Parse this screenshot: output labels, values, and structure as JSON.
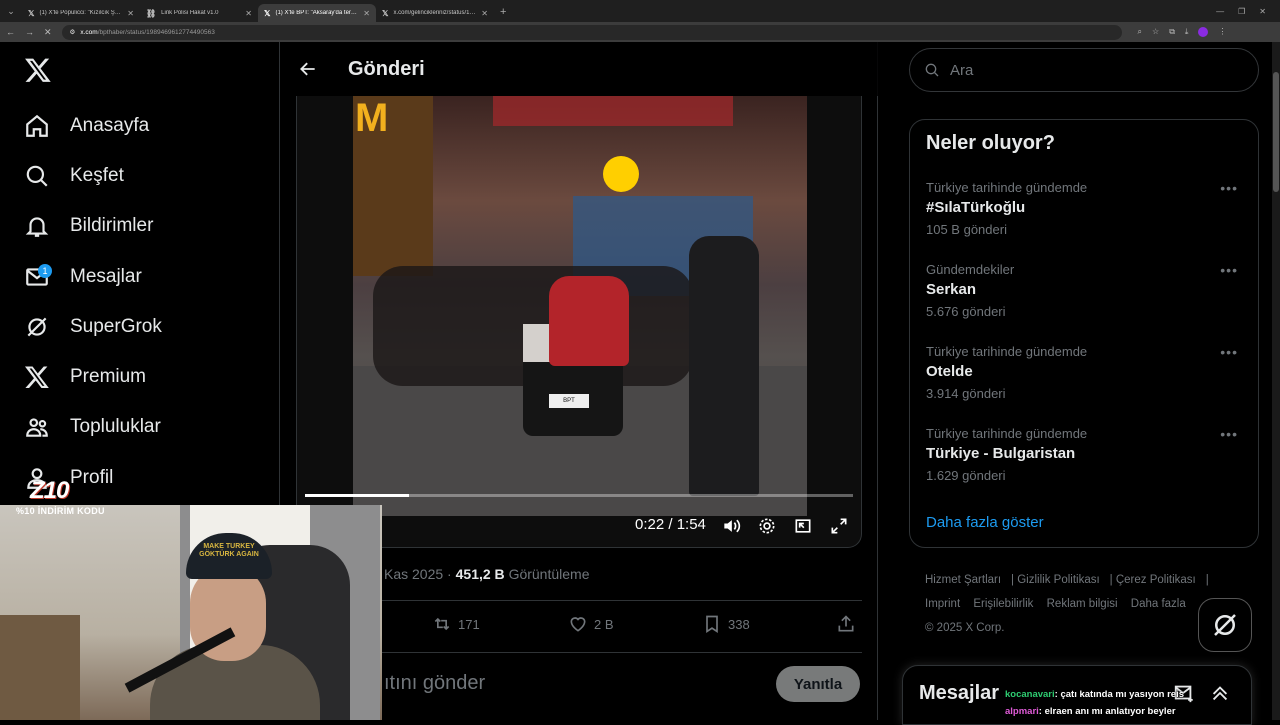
{
  "browser": {
    "tabs": [
      {
        "title": "(1) X'te Populicci: \"Kızılcık Şerbe...",
        "active": false
      },
      {
        "title": "Link Polisi Hakat v1.0",
        "active": false
      },
      {
        "title": "(1) X'te BPT: \"Aksaray'da ters yö...",
        "active": true
      },
      {
        "title": "x.com/gelincikleriniz/status/16...",
        "active": false
      }
    ],
    "url_host": "x.com",
    "url_path": "/bpthaber/status/1989469612774490563"
  },
  "nav": {
    "items": [
      {
        "label": "Anasayfa",
        "icon": "home-icon"
      },
      {
        "label": "Keşfet",
        "icon": "search-icon"
      },
      {
        "label": "Bildirimler",
        "icon": "bell-icon"
      },
      {
        "label": "Mesajlar",
        "icon": "mail-icon",
        "badge": "1"
      },
      {
        "label": "SuperGrok",
        "icon": "grok-icon"
      },
      {
        "label": "Premium",
        "icon": "x-logo-icon"
      },
      {
        "label": "Topluluklar",
        "icon": "communities-icon"
      },
      {
        "label": "Profil",
        "icon": "profile-icon"
      }
    ]
  },
  "main": {
    "title": "Gönderi",
    "video": {
      "time": "0:22 / 1:54",
      "progress": 0.19,
      "watermark": "BPT"
    },
    "post_date": "Kas 2025",
    "views_count": "451,2 B",
    "views_label": "Görüntüleme",
    "actions": {
      "reposts": "171",
      "likes": "2 B",
      "bookmarks": "338"
    },
    "reply_placeholder": "ıtını gönder",
    "reply_button": "Yanıtla"
  },
  "webcam": {
    "logo": "Z10",
    "code": "%10 İNDİRİM KODU",
    "cap_text": "MAKE TURKEY GÖKTÜRK AGAIN"
  },
  "sidebar": {
    "search_placeholder": "Ara",
    "trends_title": "Neler oluyor?",
    "trends": [
      {
        "context": "Türkiye tarihinde gündemde",
        "name": "#SılaTürkoğlu",
        "count": "105 B gönderi"
      },
      {
        "context": "Gündemdekiler",
        "name": "Serkan",
        "count": "5.676 gönderi"
      },
      {
        "context": "Türkiye tarihinde gündemde",
        "name": "Otelde",
        "count": "3.914 gönderi"
      },
      {
        "context": "Türkiye tarihinde gündemde",
        "name": "Türkiye - Bulgaristan",
        "count": "1.629 gönderi"
      }
    ],
    "show_more": "Daha fazla göster",
    "footer": [
      "Hizmet Şartları",
      "Gizlilik Politikası",
      "Çerez Politikası",
      "Imprint",
      "Erişilebilirlik",
      "Reklam bilgisi",
      "Daha fazla",
      "© 2025 X Corp."
    ],
    "messages_title": "Mesajlar"
  },
  "chat": [
    {
      "user": "kocanavari",
      "text": ": çatı katında mı yasıyon reis"
    },
    {
      "user": "alpmari",
      "text": ": elraen anı mı anlatıyor beyler"
    }
  ],
  "colors": {
    "accent": "#1d9bf0",
    "text": "#e7e9ea",
    "muted": "#71767b",
    "border": "#2f3336"
  }
}
